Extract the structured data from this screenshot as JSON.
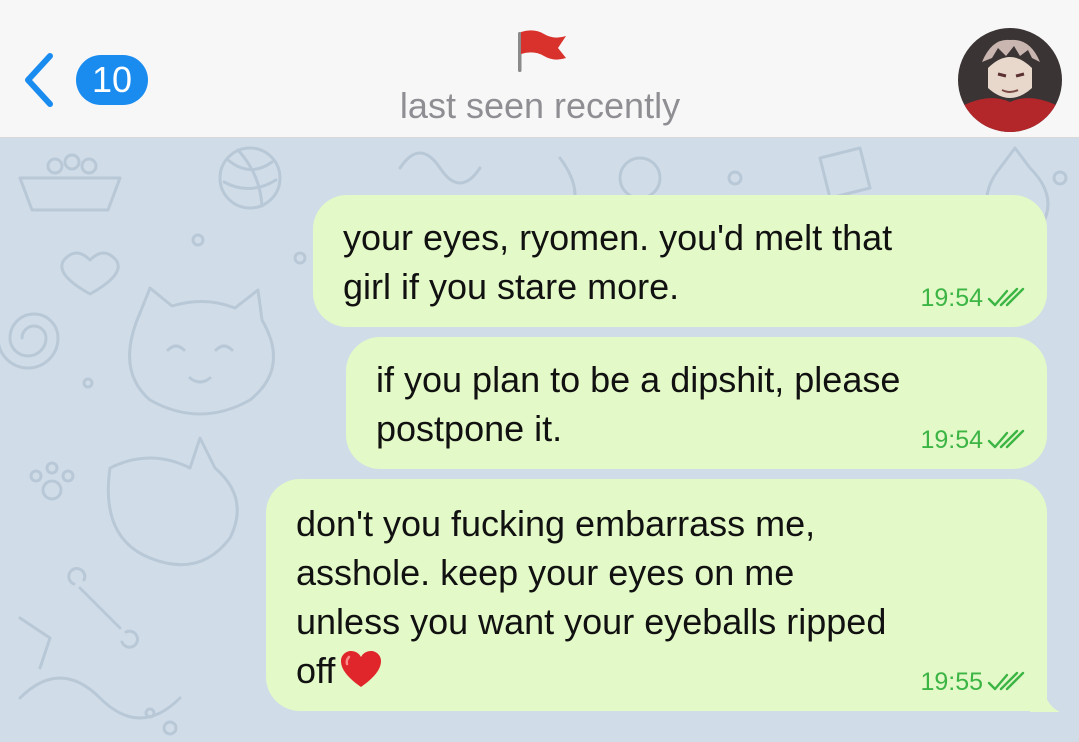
{
  "header": {
    "back_label": "",
    "unread_count": "10",
    "title_icon": "red-flag-icon",
    "status": "last seen recently",
    "avatar": "contact-avatar"
  },
  "messages": [
    {
      "lines": [
        "your eyes, ryomen. you'd melt that",
        "girl if you stare more."
      ],
      "time": "19:54",
      "status_icon": "double-check-icon",
      "direction": "outgoing"
    },
    {
      "lines": [
        "if you plan to be a dipshit, please",
        "postpone it."
      ],
      "time": "19:54",
      "status_icon": "double-check-icon",
      "direction": "outgoing"
    },
    {
      "lines": [
        "don't you fucking embarrass me,",
        "asshole. keep your eyes on me",
        "unless you want your eyeballs ripped",
        "off"
      ],
      "emoji": "heart-emoji-icon",
      "time": "19:55",
      "status_icon": "double-check-icon",
      "direction": "outgoing"
    }
  ],
  "colors": {
    "accent": "#1a8cf0",
    "bubble_outgoing": "#e3f9c7",
    "time_outgoing": "#3cb545",
    "chat_background": "#d0dce8",
    "flag": "#d9312b"
  }
}
